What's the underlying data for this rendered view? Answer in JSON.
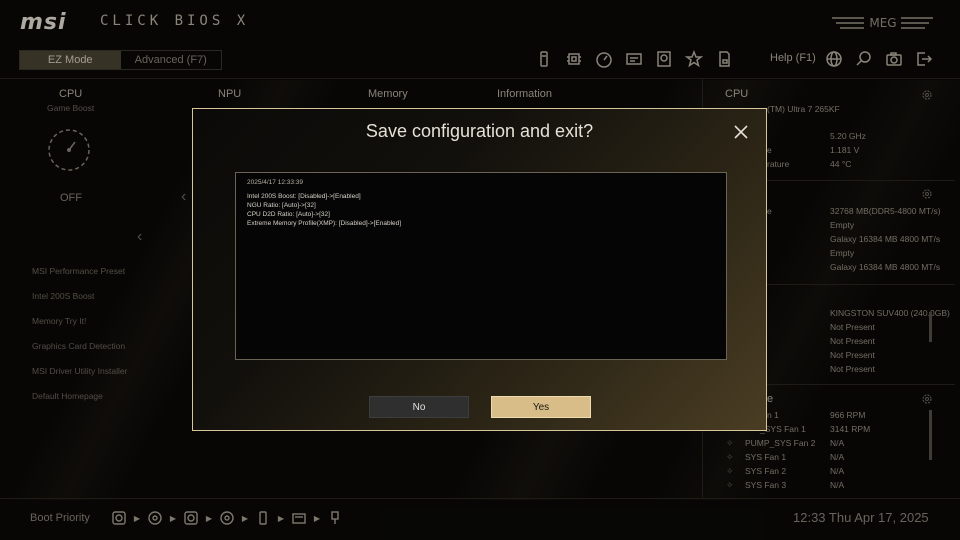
{
  "header": {
    "logo": "msi",
    "bios_title": "CLICK BIOS X",
    "ez_mode": "EZ Mode",
    "advanced_mode": "Advanced (F7)",
    "help": "Help (F1)"
  },
  "left_panel": {
    "cpu_title": "CPU",
    "cpu_sub": "Game Boost",
    "cpu_state": "OFF",
    "npu_title": "NPU",
    "memory_title": "Memory",
    "information_title": "Information",
    "menu_items": [
      "MSI Performance Preset",
      "Intel 200S Boost",
      "Memory Try It!",
      "Graphics Card Detection",
      "MSI Driver Utility Installer",
      "Default Homepage"
    ]
  },
  "right_panel": {
    "cpu_title": "CPU",
    "cpu_name": "(TM) Ultra 7 265KF",
    "cpu_freq": "5.20 GHz",
    "cpu_volt_label": "e",
    "cpu_volt": "1.181 V",
    "cpu_temp_label": "rature",
    "cpu_temp": "44 °C",
    "memory_label": "e",
    "memory_values": [
      "32768 MB(DDR5-4800 MT/s)",
      "Empty",
      "Galaxy 16384 MB 4800 MT/s",
      "Empty",
      "Galaxy 16384 MB 4800 MT/s"
    ],
    "storage_values": [
      "KINGSTON SUV400 (240.0GB)",
      "Not Present",
      "Not Present",
      "Not Present",
      "Not Present"
    ],
    "fan_title": "e",
    "fans": [
      {
        "name": "n 1",
        "value": "966 RPM"
      },
      {
        "name": "_SYS Fan 1",
        "value": "3141 RPM"
      },
      {
        "name": "PUMP_SYS Fan 2",
        "value": "N/A"
      },
      {
        "name": "SYS Fan 1",
        "value": "N/A"
      },
      {
        "name": "SYS Fan 2",
        "value": "N/A"
      },
      {
        "name": "SYS Fan 3",
        "value": "N/A"
      }
    ]
  },
  "footer": {
    "boot_priority": "Boot Priority",
    "clock": "12:33  Thu Apr 17, 2025"
  },
  "dialog": {
    "title": "Save configuration and exit?",
    "timestamp": "2025/4/17 12:33:39",
    "changes": [
      "Intel 200S Boost: [Disabled]->[Enabled]",
      "NGU Ratio: [Auto]->[32]",
      "CPU D2D Ratio: [Auto]->[32]",
      "Extreme Memory Profile(XMP): [Disabled]->[Enabled]"
    ],
    "no_label": "No",
    "yes_label": "Yes"
  },
  "colors": {
    "accent_gold": "#d8bd88",
    "dialog_border": "#d9c59b",
    "background": "#0a0907"
  }
}
